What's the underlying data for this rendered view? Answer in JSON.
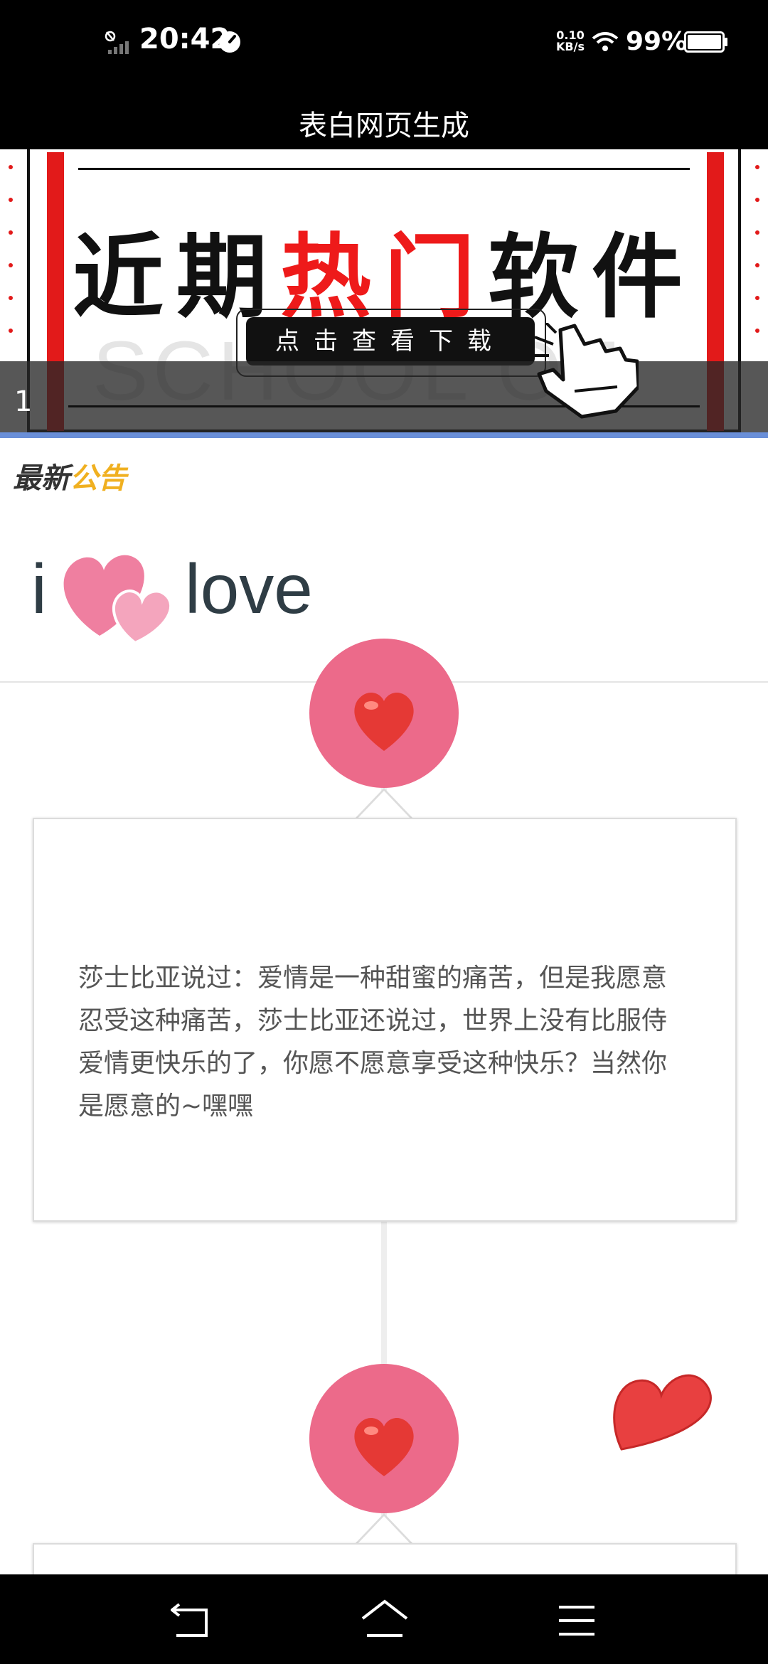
{
  "status_bar": {
    "time": "20:42",
    "net_speed_value": "0.10",
    "net_speed_unit": "KB/s",
    "battery": "99%"
  },
  "app_bar": {
    "title": "表白网页生成"
  },
  "banner": {
    "headline_part1": "近期",
    "headline_hot": "热门",
    "headline_part2": "软件",
    "cta": "点击查看下载",
    "slide_index": "1",
    "watermark": "SCHOOL OF DIS"
  },
  "notice": {
    "label_part1": "最新",
    "label_part2": "公告"
  },
  "logo": {
    "i": "i",
    "word": "love"
  },
  "timeline": {
    "items": [
      {
        "text": "莎士比亚说过：爱情是一种甜蜜的痛苦，但是我愿意忍受这种痛苦，莎士比亚还说过，世界上没有比服侍爱情更快乐的了，你愿不愿意享受这种快乐？当然你是愿意的~嘿嘿"
      }
    ]
  },
  "colors": {
    "accent_pink": "#ec6a8a",
    "heart_red": "#e53935",
    "banner_red": "#e21a1a",
    "notice_gold": "#f0b020"
  },
  "icons": [
    "silent-icon",
    "signal-icon",
    "speed-icon",
    "wifi-icon",
    "battery-icon",
    "heart-icon",
    "pointer-hand-icon",
    "back-icon",
    "home-icon",
    "menu-icon"
  ]
}
